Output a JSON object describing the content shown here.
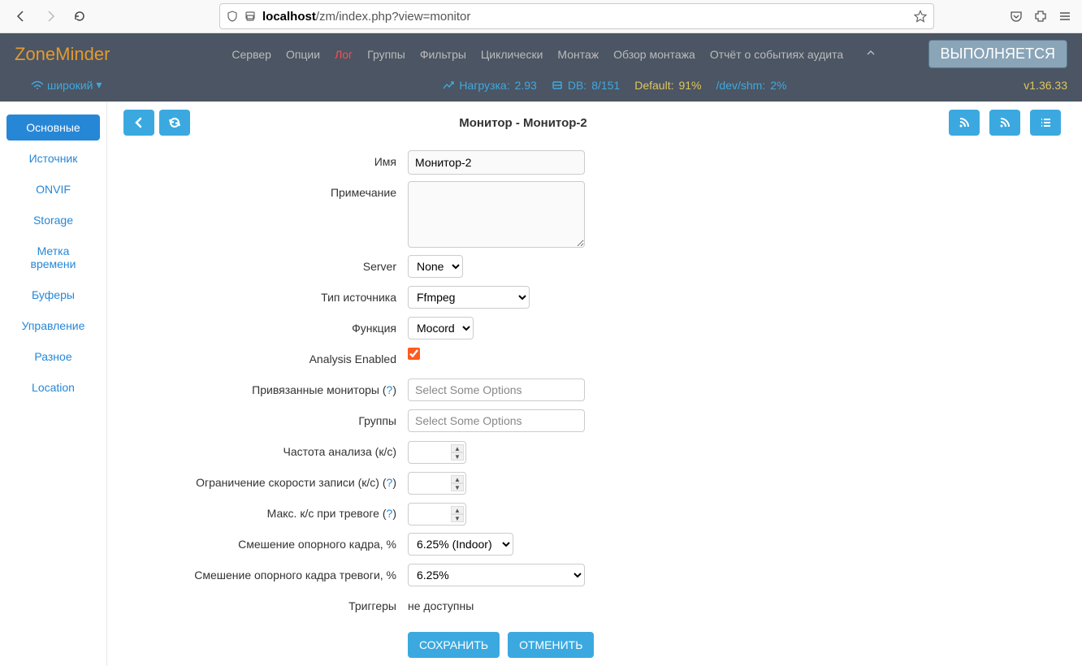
{
  "browser": {
    "url_prefix": "localhost",
    "url_path": "/zm/index.php?view=monitor"
  },
  "topbar": {
    "brand": "ZoneMinder",
    "menu": {
      "server": "Сервер",
      "options": "Опции",
      "log": "Лог",
      "groups": "Группы",
      "filters": "Фильтры",
      "cycle": "Циклически",
      "montage": "Монтаж",
      "montage_review": "Обзор монтажа",
      "audit_report": "Отчёт о событиях аудита"
    },
    "run_state": "ВЫПОЛНЯЕТСЯ",
    "bandwidth": "широкий",
    "status": {
      "load_label": "Нагрузка:",
      "load_value": "2.93",
      "db_label": "DB:",
      "db_value": "8/151",
      "default_label": "Default:",
      "default_value": "91%",
      "shm_label": "/dev/shm:",
      "shm_value": "2%"
    },
    "version": "v1.36.33"
  },
  "sidebar": {
    "general": "Основные",
    "source": "Источник",
    "onvif": "ONVIF",
    "storage": "Storage",
    "timestamp": "Метка времени",
    "buffers": "Буферы",
    "control": "Управление",
    "misc": "Разное",
    "location": "Location"
  },
  "page": {
    "title": "Монитор - Монитор-2"
  },
  "form": {
    "labels": {
      "name": "Имя",
      "notes": "Примечание",
      "server": "Server",
      "source_type": "Тип источника",
      "function": "Функция",
      "analysis_enabled": "Analysis Enabled",
      "linked_monitors": "Привязанные мониторы",
      "groups": "Группы",
      "analysis_fps": "Частота анализа (к/с)",
      "max_fps": "Ограничение скорости записи (к/с)",
      "alarm_fps": "Макс. к/с при тревоге",
      "ref_blend": "Смешение опорного кадра, %",
      "alarm_ref_blend": "Смешение опорного кадра тревоги, %",
      "triggers": "Триггеры",
      "help": "?"
    },
    "values": {
      "name": "Монитор-2",
      "notes": "",
      "server": "None",
      "source_type": "Ffmpeg",
      "function": "Mocord",
      "analysis_enabled": true,
      "linked_placeholder": "Select Some Options",
      "groups_placeholder": "Select Some Options",
      "ref_blend": "6.25% (Indoor)",
      "alarm_ref_blend": "6.25%",
      "triggers_text": "не доступны"
    },
    "buttons": {
      "save": "СОХРАНИТЬ",
      "cancel": "ОТМЕНИТЬ"
    }
  }
}
